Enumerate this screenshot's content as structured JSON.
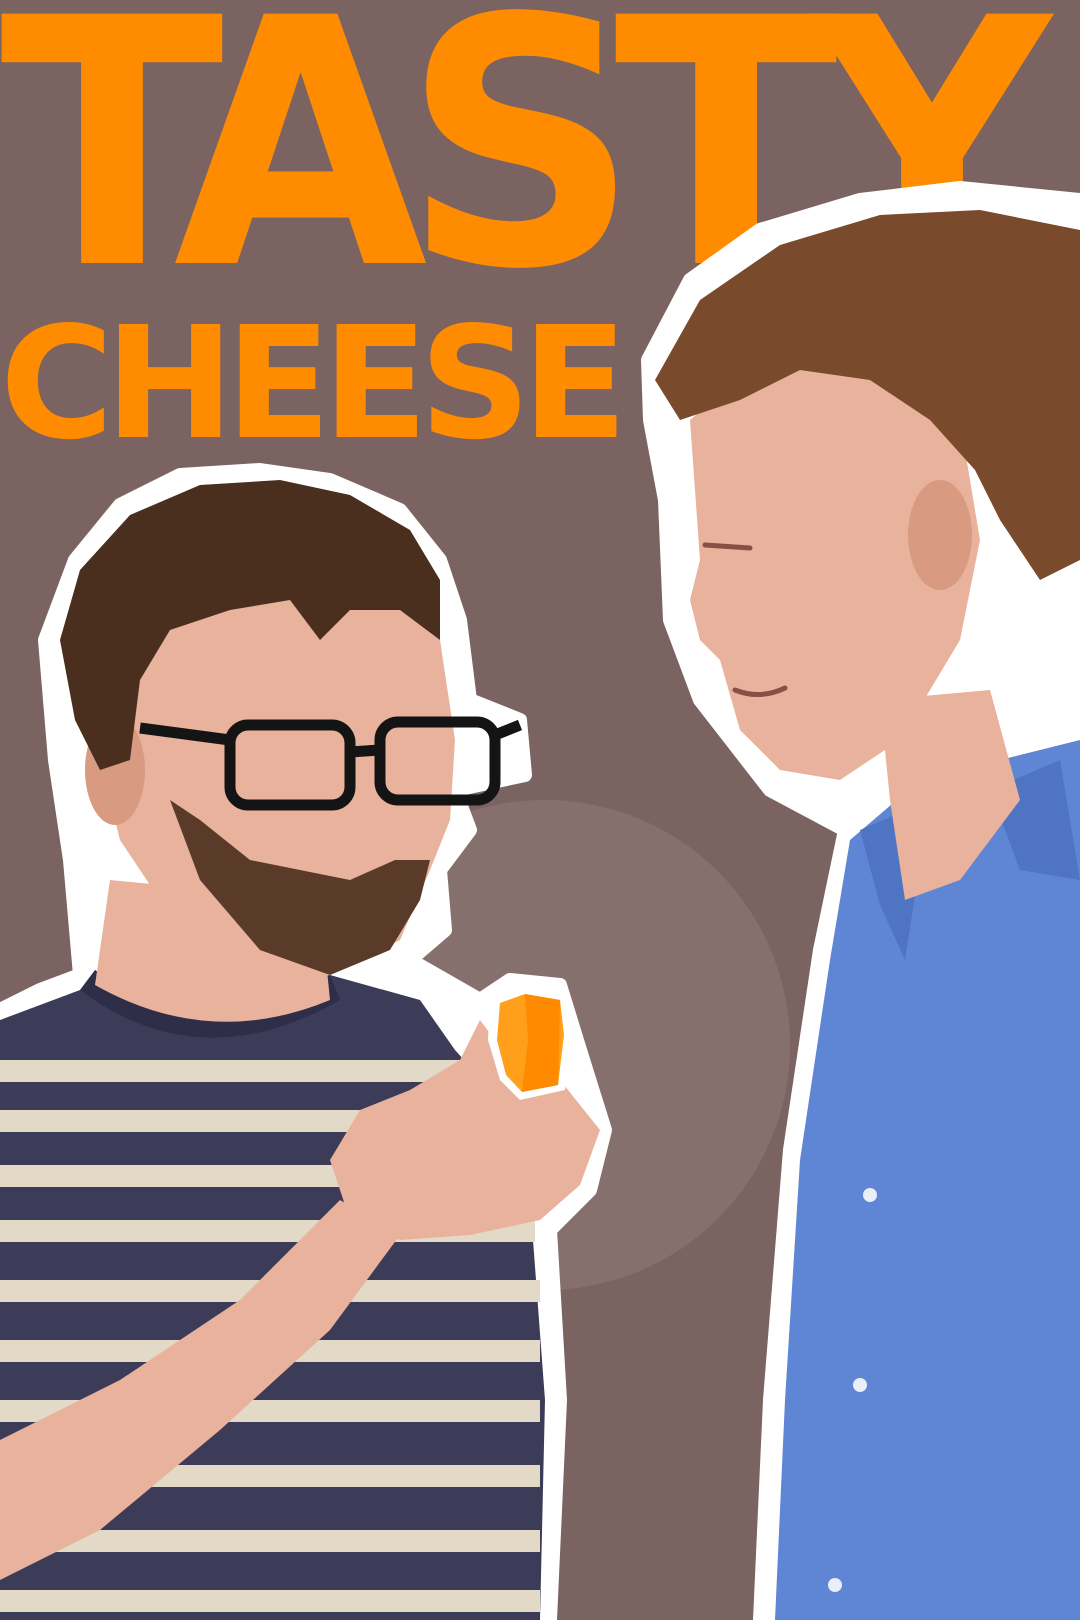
{
  "poster": {
    "title": "TASTY",
    "subtitle": "CHEESE"
  },
  "colors": {
    "background": "#7b6361",
    "circle": "#86706e",
    "title": "#ff8c00",
    "cutout_outline": "#ffffff",
    "skin": "#e8b29c",
    "hair_left": "#4a2e1e",
    "hair_right": "#7a4a2c",
    "striped_shirt": "#3c3b58",
    "stripe": "#e2d9c6",
    "blue_shirt": "#5f86d4",
    "cheese": "#ff9f1a",
    "glasses": "#141414"
  }
}
